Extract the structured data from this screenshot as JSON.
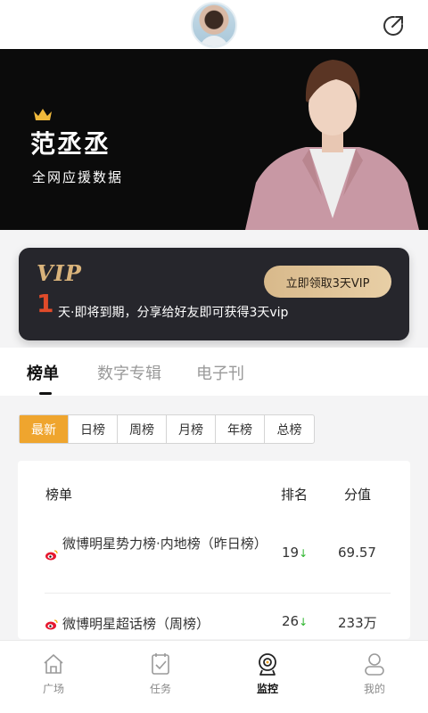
{
  "header": {
    "share_icon": "share-out-icon"
  },
  "banner": {
    "name": "范丞丞",
    "subtitle": "全网应援数据",
    "crown_color": "#f0b93b"
  },
  "vip": {
    "logo": "VIP",
    "cta": "立即领取3天VIP",
    "days_left": "1",
    "message": "天·即将到期，分享给好友即可获得3天vip"
  },
  "tabs": [
    {
      "label": "榜单",
      "active": true
    },
    {
      "label": "数字专辑",
      "active": false
    },
    {
      "label": "电子刊",
      "active": false
    }
  ],
  "filters": [
    {
      "label": "最新",
      "active": true
    },
    {
      "label": "日榜",
      "active": false
    },
    {
      "label": "周榜",
      "active": false
    },
    {
      "label": "月榜",
      "active": false
    },
    {
      "label": "年榜",
      "active": false
    },
    {
      "label": "总榜",
      "active": false
    }
  ],
  "ranking": {
    "col_list": "榜单",
    "col_rank": "排名",
    "col_score": "分值",
    "rows": [
      {
        "name": "微博明星势力榜·内地榜（昨日榜）",
        "rank": "19",
        "trend": "↓",
        "score": "69.57",
        "icon": "weibo-icon"
      },
      {
        "name": "微博明星超话榜（周榜）",
        "rank": "26",
        "trend": "↓",
        "score": "233万",
        "icon": "weibo-icon"
      }
    ]
  },
  "nav": [
    {
      "label": "广场",
      "icon": "home-icon",
      "active": false
    },
    {
      "label": "任务",
      "icon": "task-clipboard-icon",
      "active": false
    },
    {
      "label": "监控",
      "icon": "monitor-camera-icon",
      "active": true
    },
    {
      "label": "我的",
      "icon": "profile-icon",
      "active": false
    }
  ],
  "colors": {
    "accent": "#efa52e",
    "vip_gold": "#d9b37b",
    "trend_down": "#2db52d"
  }
}
